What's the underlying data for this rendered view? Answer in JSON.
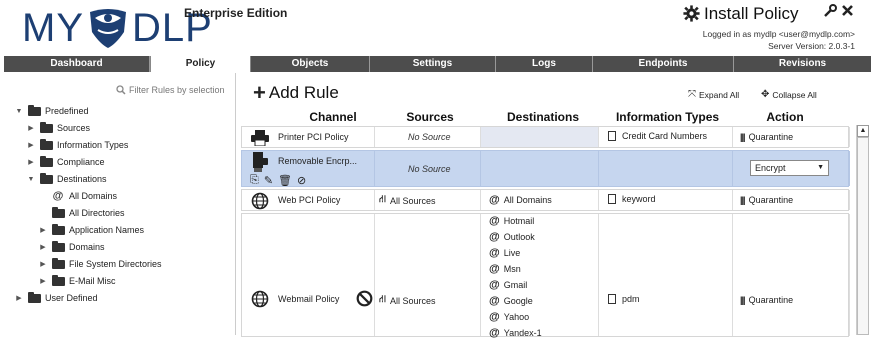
{
  "header": {
    "logo_text_left": "MY",
    "logo_text_right": "DLP",
    "edition": "Enterprise Edition",
    "install_policy": "Install Policy",
    "logged_in": "Logged in as mydlp <user@mydlp.com>",
    "server_version": "Server Version: 2.0.3-1",
    "brand_color": "#1d3f73"
  },
  "tabs": [
    "Dashboard",
    "Policy",
    "Objects",
    "Settings",
    "Logs",
    "Endpoints",
    "Revisions"
  ],
  "active_tab": "Policy",
  "sidebar": {
    "filter_label": "Filter Rules by selection",
    "tree": {
      "predefined": "Predefined",
      "sources": "Sources",
      "information_types": "Information Types",
      "compliance": "Compliance",
      "destinations": "Destinations",
      "all_domains": "All Domains",
      "all_directories": "All Directories",
      "application_names": "Application Names",
      "domains": "Domains",
      "file_system_directories": "File System Directories",
      "email_misc": "E-Mail Misc",
      "user_defined": "User Defined"
    }
  },
  "main": {
    "add_rule": "Add Rule",
    "expand_all": "Expand All",
    "collapse_all": "Collapse All",
    "columns": {
      "channel": "Channel",
      "sources": "Sources",
      "destinations": "Destinations",
      "information_types": "Information Types",
      "action": "Action"
    },
    "rules": {
      "printer": {
        "name": "Printer PCI Policy",
        "sources": "No Source",
        "info_type": "Credit Card Numbers",
        "action": "Quarantine"
      },
      "removable": {
        "name": "Removable Encrp...",
        "sources": "No Source",
        "action_select": "Encrypt"
      },
      "web": {
        "name": "Web PCI Policy",
        "sources": "All Sources",
        "destination": "All Domains",
        "info_type": "keyword",
        "action": "Quarantine"
      },
      "webmail": {
        "name": "Webmail Policy",
        "sources": "All Sources",
        "destinations": [
          "Hotmail",
          "Outlook",
          "Live",
          "Msn",
          "Gmail",
          "Google",
          "Yahoo",
          "Yandex-1"
        ],
        "info_type": "pdm",
        "action": "Quarantine"
      }
    }
  },
  "colors": {
    "tab_bar": "#4d4d4d",
    "selected_row": "#c6d6ef",
    "shaded_cell": "#e4e8f2"
  }
}
